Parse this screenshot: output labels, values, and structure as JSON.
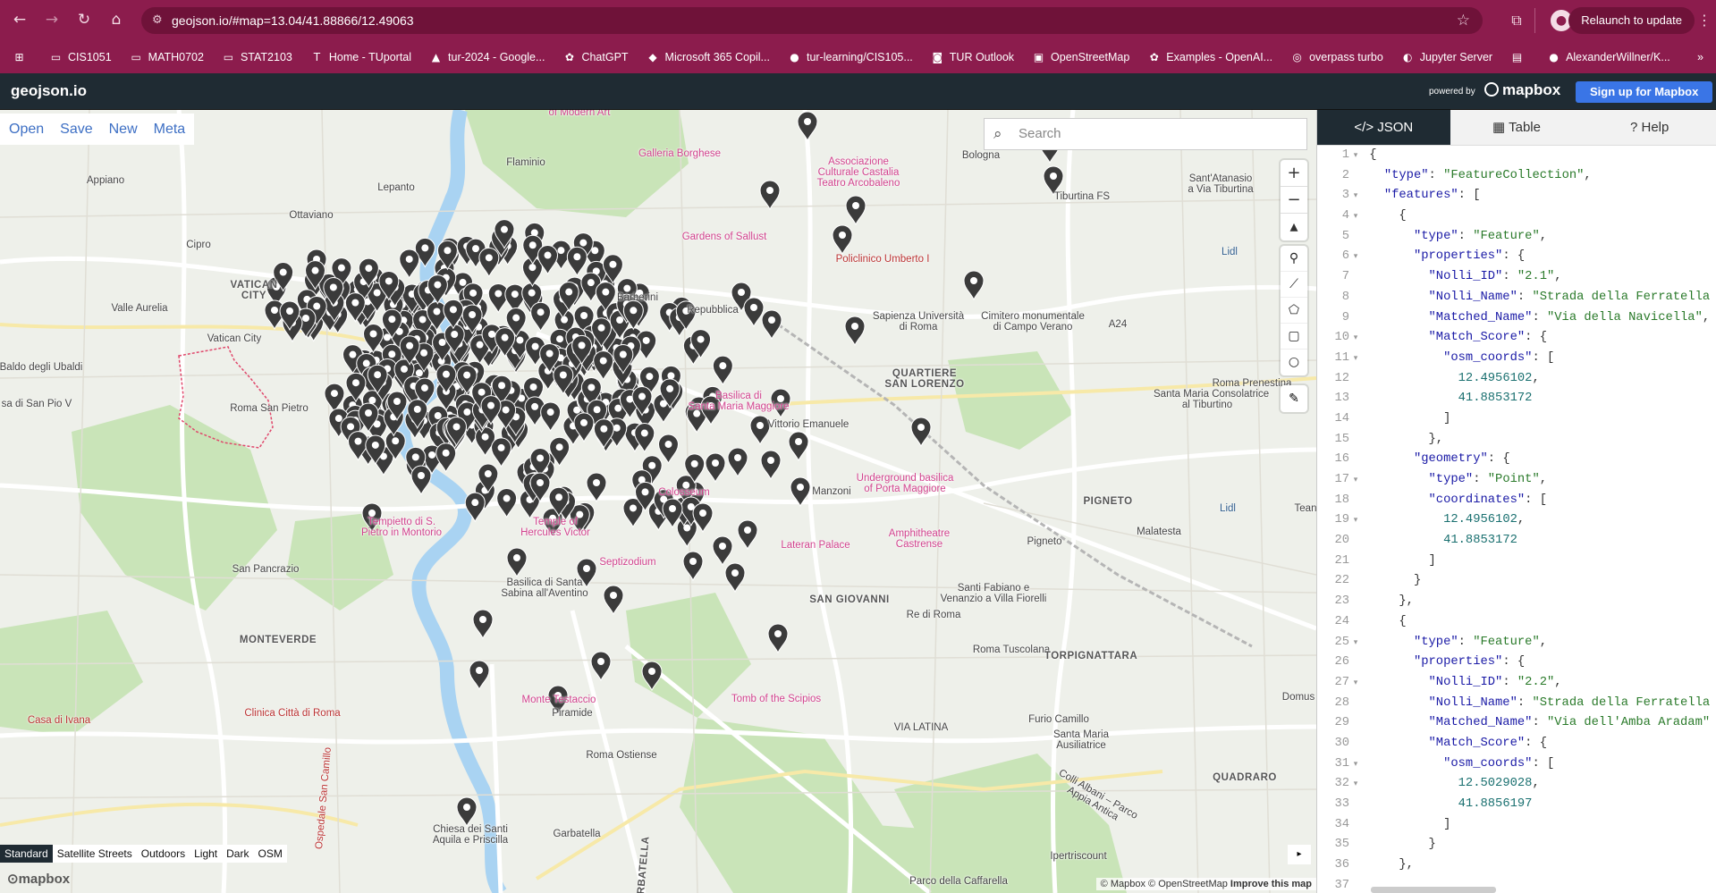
{
  "browser": {
    "url": "geojson.io/#map=13.04/41.88866/12.49063",
    "relaunch_label": "Relaunch to update"
  },
  "bookmarks": [
    {
      "label": "CIS1051",
      "icon": "folder-icon"
    },
    {
      "label": "MATH0702",
      "icon": "folder-icon"
    },
    {
      "label": "STAT2103",
      "icon": "folder-icon"
    },
    {
      "label": "Home - TUportal",
      "icon": "tu-icon"
    },
    {
      "label": "tur-2024 - Google...",
      "icon": "drive-icon"
    },
    {
      "label": "ChatGPT",
      "icon": "chatgpt-icon"
    },
    {
      "label": "Microsoft 365 Copil...",
      "icon": "copilot-icon"
    },
    {
      "label": "tur-learning/CIS105...",
      "icon": "github-icon"
    },
    {
      "label": "TUR Outlook",
      "icon": "outlook-icon"
    },
    {
      "label": "OpenStreetMap",
      "icon": "osm-icon"
    },
    {
      "label": "Examples - OpenAI...",
      "icon": "openai-icon"
    },
    {
      "label": "overpass turbo",
      "icon": "overpass-icon"
    },
    {
      "label": "Jupyter Server",
      "icon": "jupyter-icon"
    },
    {
      "label": "",
      "icon": "app-icon"
    },
    {
      "label": "AlexanderWillner/K...",
      "icon": "github-icon"
    }
  ],
  "app": {
    "logo": "geojson.io",
    "powered_by": "powered by",
    "mapbox_brand": "mapbox",
    "signup_label": "Sign up for Mapbox"
  },
  "map_menu": {
    "open": "Open",
    "save": "Save",
    "new": "New",
    "meta": "Meta"
  },
  "search": {
    "placeholder": "Search"
  },
  "map_styles": {
    "options": [
      "Standard",
      "Satellite Streets",
      "Outdoors",
      "Light",
      "Dark",
      "OSM"
    ],
    "selected": "Standard"
  },
  "map_logo": "mapbox",
  "attribution": {
    "mapbox": "© Mapbox",
    "osm": "© OpenStreetMap",
    "improve": "Improve this map"
  },
  "colors": {
    "browser_bar": "#8c1c4d",
    "app_header": "#1f2b33",
    "signup": "#3a75e6",
    "marker": "#3b3b3b",
    "link": "#3d6fc4"
  },
  "map_labels": [
    {
      "text": "National Gallery of Modern Art",
      "lines": [
        "National Gallery",
        "of Modern Art"
      ],
      "cls": "pink"
    },
    {
      "text": "Galleria Borghese",
      "cls": "pink"
    },
    {
      "text": "Associazione Culturale Castalia Teatro Arcobaleno",
      "lines": [
        "Associazione",
        "Culturale Castalia",
        "Teatro Arcobaleno"
      ],
      "cls": "pink"
    },
    {
      "text": "Bologna",
      "cls": ""
    },
    {
      "text": "Sant'Atanasio a Via Tiburtina",
      "lines": [
        "Sant'Atanasio",
        "a Via Tiburtina"
      ],
      "cls": ""
    },
    {
      "text": "Appiano",
      "cls": ""
    },
    {
      "text": "Lepanto",
      "cls": ""
    },
    {
      "text": "Flaminio",
      "cls": ""
    },
    {
      "text": "Tiburtina FS",
      "cls": ""
    },
    {
      "text": "Ottaviano",
      "cls": ""
    },
    {
      "text": "Gardens of Sallust",
      "cls": "pink"
    },
    {
      "text": "Cipro",
      "cls": ""
    },
    {
      "text": "Policlinico Umberto I",
      "cls": "red"
    },
    {
      "text": "Lidl",
      "cls": "blue"
    },
    {
      "text": "VATICAN CITY",
      "lines": [
        "VATICAN",
        "CITY"
      ],
      "cls": "bold"
    },
    {
      "text": "Valle Aurelia",
      "cls": ""
    },
    {
      "text": "Barberini",
      "cls": ""
    },
    {
      "text": "Repubblica",
      "cls": ""
    },
    {
      "text": "Sapienza Università di Roma",
      "lines": [
        "Sapienza Università",
        "di Roma"
      ],
      "cls": ""
    },
    {
      "text": "Cimitero monumentale di Campo Verano",
      "lines": [
        "Cimitero monumentale",
        "di Campo Verano"
      ],
      "cls": ""
    },
    {
      "text": "A24",
      "cls": ""
    },
    {
      "text": "Vatican City",
      "cls": ""
    },
    {
      "text": "Baldo degli Ubaldi",
      "cls": ""
    },
    {
      "text": "QUARTIERE SAN LORENZO",
      "lines": [
        "QUARTIERE",
        "SAN LORENZO"
      ],
      "cls": "bold"
    },
    {
      "text": "Roma Prenestina",
      "cls": ""
    },
    {
      "text": "Santa Maria Consolatrice al Tiburtino",
      "lines": [
        "Santa Maria Consolatrice",
        "al Tiburtino"
      ],
      "cls": ""
    },
    {
      "text": "sa di San Pio V",
      "cls": ""
    },
    {
      "text": "Roma San Pietro",
      "cls": ""
    },
    {
      "text": "Santa Maria Maggiore",
      "lines": [
        "Basilica di",
        "Santa Maria Maggiore"
      ],
      "cls": "pink"
    },
    {
      "text": "Vittorio Emanuele",
      "cls": ""
    },
    {
      "text": "Underground basilica of Porta Maggiore",
      "lines": [
        "Underground basilica",
        "of Porta Maggiore"
      ],
      "cls": "pink"
    },
    {
      "text": "Colosseum",
      "cls": "pink"
    },
    {
      "text": "Manzoni",
      "cls": ""
    },
    {
      "text": "PIGNETO",
      "cls": "bold"
    },
    {
      "text": "Lidl",
      "cls": "blue"
    },
    {
      "text": "Malatesta",
      "cls": ""
    },
    {
      "text": "Tempietto di S. Pietro in Montorio",
      "lines": [
        "Tempietto di S.",
        "Pietro in Montorio"
      ],
      "cls": "pink"
    },
    {
      "text": "Temple of Hercules Victor",
      "lines": [
        "Temple of",
        "Hercules Victor"
      ],
      "cls": "pink"
    },
    {
      "text": "Amphitheatre Castrense",
      "lines": [
        "Amphitheatre",
        "Castrense"
      ],
      "cls": "pink"
    },
    {
      "text": "Lateran Palace",
      "cls": "pink"
    },
    {
      "text": "Pigneto",
      "cls": ""
    },
    {
      "text": "San Pancrazio",
      "cls": ""
    },
    {
      "text": "Basilica di Santa Sabina all'Aventino",
      "lines": [
        "Basilica di Santa",
        "Sabina all'Aventino"
      ],
      "cls": ""
    },
    {
      "text": "Septizodium",
      "cls": "pink"
    },
    {
      "text": "SAN GIOVANNI",
      "cls": "bold"
    },
    {
      "text": "Santi Fabiano e Venanzio a Villa Fiorelli",
      "lines": [
        "Santi Fabiano e",
        "Venanzio a Villa Fiorelli"
      ],
      "cls": ""
    },
    {
      "text": "Re di Roma",
      "cls": ""
    },
    {
      "text": "MONTEVERDE",
      "cls": "bold"
    },
    {
      "text": "Roma Tuscolana",
      "cls": ""
    },
    {
      "text": "TORPIGNATTARA",
      "cls": "bold"
    },
    {
      "text": "Clinica Città di Roma",
      "cls": "red"
    },
    {
      "text": "Monte Testaccio",
      "cls": "pink"
    },
    {
      "text": "Tomb of the Scipios",
      "cls": "pink"
    },
    {
      "text": "Piramide",
      "cls": ""
    },
    {
      "text": "Furio Camillo",
      "cls": ""
    },
    {
      "text": "Santa Maria Ausiliatrice",
      "lines": [
        "Santa Maria",
        "Ausiliatrice"
      ],
      "cls": ""
    },
    {
      "text": "Casa di Ivana",
      "cls": "red"
    },
    {
      "text": "Roma Ostiense",
      "cls": ""
    },
    {
      "text": "VIA LATINA",
      "cls": ""
    },
    {
      "text": "Ospedale San Camillo",
      "cls": "red"
    },
    {
      "text": "Colli Albani - Parco Appia Antica",
      "lines": [
        "Colli Albani – Parco",
        "Appia Antica"
      ],
      "cls": ""
    },
    {
      "text": "QUADRARO",
      "cls": "bold"
    },
    {
      "text": "Chiesa del Santi Aquila e Priscilla",
      "lines": [
        "Chiesa dei Santi",
        "Aquila e Priscilla"
      ],
      "cls": ""
    },
    {
      "text": "Garbatella",
      "cls": ""
    },
    {
      "text": "Ipertriscount",
      "cls": ""
    },
    {
      "text": "GARBATELLA",
      "cls": "bold"
    },
    {
      "text": "Parco della Caffarella",
      "cls": ""
    },
    {
      "text": "Domus",
      "cls": ""
    },
    {
      "text": "Tean",
      "cls": ""
    }
  ],
  "panel": {
    "tabs": [
      {
        "label": "JSON",
        "icon": "code-icon",
        "active": true
      },
      {
        "label": "Table",
        "icon": "table-icon",
        "active": false
      },
      {
        "label": "Help",
        "icon": "question-icon",
        "active": false
      }
    ]
  },
  "code_lines": [
    "{",
    "  \"type\": \"FeatureCollection\",",
    "  \"features\": [",
    "    {",
    "      \"type\": \"Feature\",",
    "      \"properties\": {",
    "        \"Nolli_ID\": \"2.1\",",
    "        \"Nolli_Name\": \"Strada della Ferratella",
    "        \"Matched_Name\": \"Via della Navicella\",",
    "        \"Match_Score\": {",
    "          \"osm_coords\": [",
    "            12.4956102,",
    "            41.8853172",
    "          ]",
    "        },",
    "      \"geometry\": {",
    "        \"type\": \"Point\",",
    "        \"coordinates\": [",
    "          12.4956102,",
    "          41.8853172",
    "        ]",
    "      }",
    "    },",
    "    {",
    "      \"type\": \"Feature\",",
    "      \"properties\": {",
    "        \"Nolli_ID\": \"2.2\",",
    "        \"Nolli_Name\": \"Strada della Ferratella",
    "        \"Matched_Name\": \"Via dell'Amba Aradam\"",
    "        \"Match_Score\": {",
    "          \"osm_coords\": [",
    "            12.5029028,",
    "            41.8856197",
    "          ]",
    "        }",
    "    },"
  ],
  "code_numbers": [
    "1",
    "2",
    "3",
    "4",
    "5",
    "6",
    "7",
    "8",
    "9",
    "10",
    "11",
    "12",
    "13",
    "14",
    "15",
    "16",
    "17",
    "18",
    "19",
    "20",
    "21",
    "22",
    "23",
    "24",
    "25",
    "26",
    "27",
    "28",
    "29",
    "30",
    "31",
    "32",
    "33",
    "34",
    "35",
    "36",
    "37"
  ]
}
